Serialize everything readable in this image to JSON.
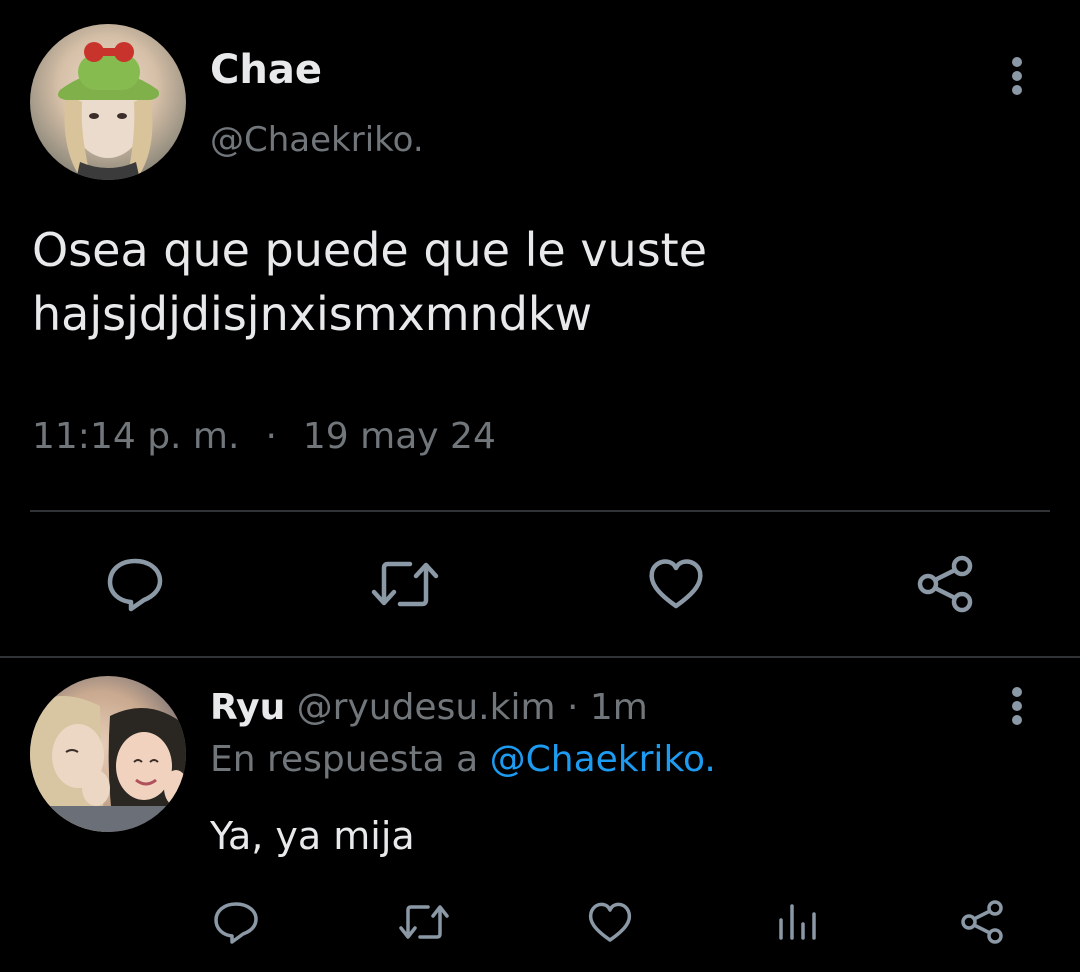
{
  "main_tweet": {
    "author_name": "Chae",
    "author_handle": "@Chaekriko.",
    "text_line1": "Osea que puede que le vuste",
    "text_line2": "hajsjdjdisjnxismxmndkw",
    "time": "11:14 p. m.",
    "separator": "·",
    "date": "19 may 24"
  },
  "reply": {
    "author_name": "Ryu",
    "author_handle": "@ryudesu.kim",
    "separator": "·",
    "age": "1m",
    "reply_prefix": "En respuesta a",
    "reply_mention": "@Chaekriko.",
    "text": "Ya, ya mija"
  },
  "icons": {
    "reply": "comment-icon",
    "retweet": "retweet-icon",
    "like": "heart-icon",
    "views": "analytics-icon",
    "share": "share-icon",
    "more": "more-vertical-icon"
  },
  "colors": {
    "background": "#000000",
    "primary_text": "#e7e9ea",
    "secondary_text": "#71767b",
    "accent": "#1d9bf0",
    "divider": "#2f3336",
    "icon": "#8b98a5"
  }
}
